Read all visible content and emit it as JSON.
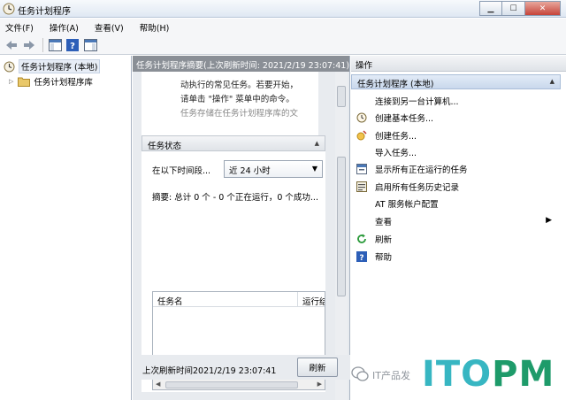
{
  "window": {
    "title": "任务计划程序"
  },
  "menu": [
    "文件(F)",
    "操作(A)",
    "查看(V)",
    "帮助(H)"
  ],
  "tree": {
    "root": "任务计划程序 (本地)",
    "child": "任务计划程序库"
  },
  "middle": {
    "header": "任务计划程序摘要(上次刷新时间: 2021/2/19 23:07:41)",
    "summary_lines": [
      "动执行的常见任务。若要开始，",
      "请单击 \"操作\" 菜单中的命令。",
      "任务存储在任务计划程序库的文"
    ],
    "status_section": "任务状态",
    "period_label": "在以下时间段...",
    "period_value": "近 24 小时",
    "stats": "摘要: 总计 0 个 - 0 个正在运行，0 个成功...",
    "columns": [
      "任务名",
      "运行结"
    ],
    "last_refresh": "上次刷新时间2021/2/19 23:07:41",
    "refresh_button": "刷新"
  },
  "actions": {
    "header": "操作",
    "group": "任务计划程序 (本地)",
    "items": [
      {
        "label": "连接到另一台计算机...",
        "icon": "none"
      },
      {
        "label": "创建基本任务...",
        "icon": "clock-icon"
      },
      {
        "label": "创建任务...",
        "icon": "create-task-icon"
      },
      {
        "label": "导入任务...",
        "icon": "none"
      },
      {
        "label": "显示所有正在运行的任务",
        "icon": "running-tasks-icon"
      },
      {
        "label": "启用所有任务历史记录",
        "icon": "history-icon"
      },
      {
        "label": "AT 服务帐户配置",
        "icon": "none"
      },
      {
        "label": "查看",
        "icon": "none"
      },
      {
        "label": "刷新",
        "icon": "refresh-icon"
      },
      {
        "label": "帮助",
        "icon": "help-icon"
      }
    ]
  },
  "watermark": {
    "text": "IT产品发",
    "logo": "ITOPM"
  },
  "colors": {
    "header_gray": "#8a8f96",
    "group_blue": "#c9d8ec",
    "logo_teal": "#37b6c2",
    "logo_green": "#1e9b6a"
  }
}
